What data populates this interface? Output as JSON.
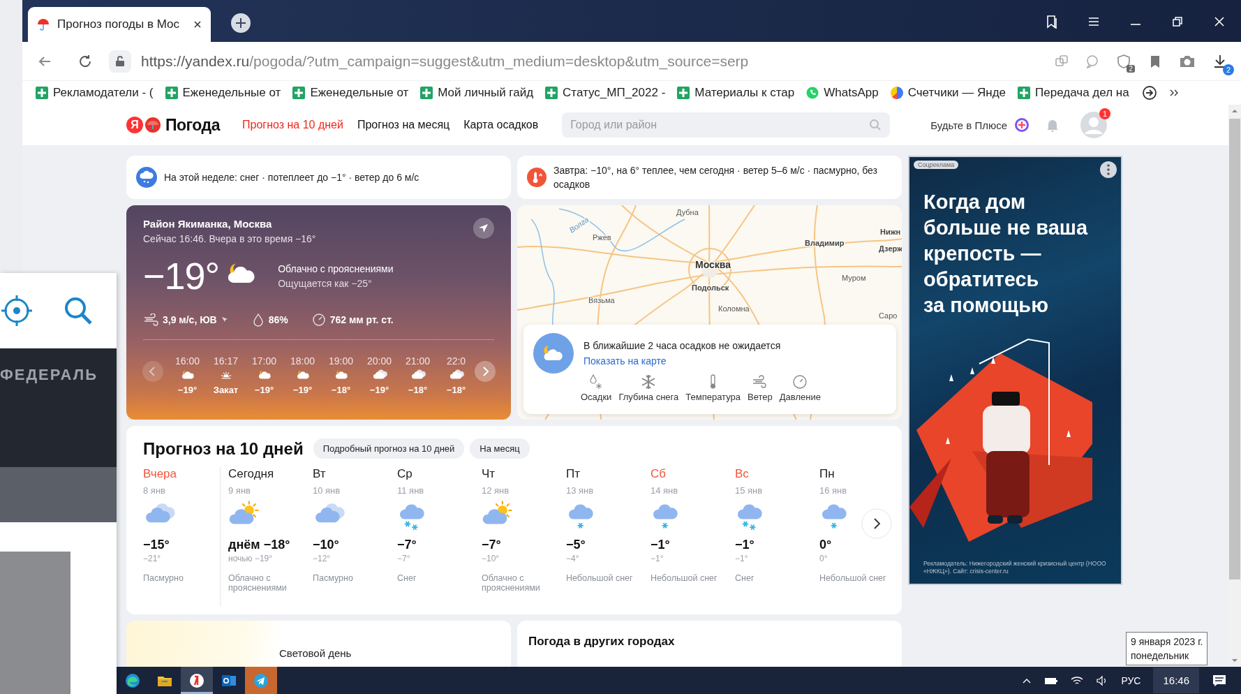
{
  "browser": {
    "tab": {
      "title": "Прогноз погоды в Мос"
    },
    "address": {
      "host": "https://yandex.ru",
      "path": "/pogoda/?utm_campaign=suggest&utm_medium=desktop&utm_source=serp"
    },
    "badges": [
      "2",
      "2"
    ],
    "bookmarks": [
      {
        "label": "Рекламодатели - (",
        "kind": "sheet"
      },
      {
        "label": "Еженедельные от",
        "kind": "sheet"
      },
      {
        "label": "Еженедельные от",
        "kind": "sheet"
      },
      {
        "label": "Мой личный гайд",
        "kind": "sheet"
      },
      {
        "label": "Статус_МП_2022 -",
        "kind": "sheet"
      },
      {
        "label": "Материалы к стар",
        "kind": "sheet"
      },
      {
        "label": "WhatsApp",
        "kind": "whatsapp"
      },
      {
        "label": "Счетчики — Янде",
        "kind": "metrica"
      },
      {
        "label": "Передача дел на",
        "kind": "sheet"
      }
    ]
  },
  "header": {
    "logo_letter": "Я",
    "logo_text": "Погода",
    "nav": [
      {
        "label": "Прогноз на 10 дней",
        "selected": true
      },
      {
        "label": "Прогноз на месяц",
        "selected": false
      },
      {
        "label": "Карта осадков",
        "selected": false
      }
    ],
    "search": {
      "placeholder": "Город или район"
    },
    "plus_label": "Будьте в Плюсе",
    "avatar_badge": "1"
  },
  "alerts": [
    {
      "kind": "snow",
      "text": "На этой неделе: снег · потеплеет до −1° · ветер до 6 м/с"
    },
    {
      "kind": "warm",
      "text": "Завтра: −10°, на 6° теплее, чем сегодня · ветер 5–6 м/с · пасмурно, без осадков"
    }
  ],
  "now": {
    "location": "Район Якиманка, Москва",
    "subtitle": "Сейчас 16:46. Вчера в это время −16°",
    "temp": "−19°",
    "kind": "moon-cloud",
    "condition": "Облачно с прояснениями",
    "feels": "Ощущается как −25°",
    "wind": "3,9 м/с, ЮВ",
    "humidity": "86%",
    "pressure": "762 мм рт. ст.",
    "hours": [
      {
        "time": "16:00",
        "kind": "moon-cloud",
        "temp": "−19°"
      },
      {
        "time": "16:17",
        "kind": "sunset",
        "temp": "Закат"
      },
      {
        "time": "17:00",
        "kind": "moon-cloud",
        "temp": "−19°"
      },
      {
        "time": "18:00",
        "kind": "moon-cloud",
        "temp": "−19°"
      },
      {
        "time": "19:00",
        "kind": "moon-cloud",
        "temp": "−18°"
      },
      {
        "time": "20:00",
        "kind": "cloudy",
        "temp": "−19°"
      },
      {
        "time": "21:00",
        "kind": "cloudy",
        "temp": "−18°"
      },
      {
        "time": "22:0",
        "kind": "cloudy",
        "temp": "−18°"
      }
    ]
  },
  "map": {
    "labels": [
      {
        "text": "Волга",
        "kind": "river"
      },
      {
        "text": "Дубна",
        "kind": "town"
      },
      {
        "text": "Ржев",
        "kind": "town"
      },
      {
        "text": "Москва",
        "kind": "capital"
      },
      {
        "text": "Подольск",
        "kind": "city"
      },
      {
        "text": "Вязьма",
        "kind": "town"
      },
      {
        "text": "Коломна",
        "kind": "town"
      },
      {
        "text": "Владимир",
        "kind": "city"
      },
      {
        "text": "Муром",
        "kind": "town"
      },
      {
        "text": "Нижн",
        "kind": "city"
      },
      {
        "text": "Дзерж",
        "kind": "city"
      },
      {
        "text": "Саро",
        "kind": "town"
      }
    ],
    "precip": {
      "text": "В ближайшие 2 часа осадков не ожидается",
      "link": "Показать на карте",
      "layers": [
        {
          "kind": "precip",
          "label": "Осадки"
        },
        {
          "kind": "snow",
          "label": "Глубина снега"
        },
        {
          "kind": "temp",
          "label": "Температура"
        },
        {
          "kind": "wind",
          "label": "Ветер"
        },
        {
          "kind": "pressure",
          "label": "Давление"
        }
      ]
    }
  },
  "forecast": {
    "title": "Прогноз на 10 дней",
    "buttons": [
      "Подробный прогноз на 10 дней",
      "На месяц"
    ],
    "days": [
      {
        "name": "Вчера",
        "date": "8 янв",
        "kind": "cloudy",
        "day": "−15°",
        "night": "−21°",
        "condition": "Пасмурно",
        "accent": true
      },
      {
        "name": "Сегодня",
        "date": "9 янв",
        "kind": "sun-cloud",
        "day": "днём −18°",
        "night": "ночью −19°",
        "condition": "Облачно с прояснениями",
        "accent": false
      },
      {
        "name": "Вт",
        "date": "10 янв",
        "kind": "cloudy",
        "day": "−10°",
        "night": "−12°",
        "condition": "Пасмурно",
        "accent": false
      },
      {
        "name": "Ср",
        "date": "11 янв",
        "kind": "snow",
        "day": "−7°",
        "night": "−7°",
        "condition": "Снег",
        "accent": false
      },
      {
        "name": "Чт",
        "date": "12 янв",
        "kind": "sun-cloud",
        "day": "−7°",
        "night": "−10°",
        "condition": "Облачно с прояснениями",
        "accent": false
      },
      {
        "name": "Пт",
        "date": "13 янв",
        "kind": "light-snow",
        "day": "−5°",
        "night": "−4°",
        "condition": "Небольшой снег",
        "accent": false
      },
      {
        "name": "Сб",
        "date": "14 янв",
        "kind": "light-snow",
        "day": "−1°",
        "night": "−1°",
        "condition": "Небольшой снег",
        "accent": true
      },
      {
        "name": "Вс",
        "date": "15 янв",
        "kind": "snow",
        "day": "−1°",
        "night": "−1°",
        "condition": "Снег",
        "accent": true
      },
      {
        "name": "Пн",
        "date": "16 янв",
        "kind": "light-snow",
        "day": "0°",
        "night": "0°",
        "condition": "Небольшой снег",
        "accent": false
      }
    ]
  },
  "bottom": {
    "daylight_label": "Световой день",
    "other_cities_title": "Погода в других городах"
  },
  "ad": {
    "badge": "Соцреклама",
    "headline": [
      "Когда дом",
      "больше не ваша",
      "крепость —",
      "обратитесь",
      "за помощью"
    ],
    "disclaimer": "Рекламодатель: Нижегородский женский кризисный центр (НООО «НЖКЦ»). Сайт: crisis-center.ru"
  },
  "left_window": {
    "banner": "ФЕДЕРАЛЬ"
  },
  "taskbar": {
    "apps": [
      {
        "kind": "edge",
        "selected": false,
        "flashing": false
      },
      {
        "kind": "explorer",
        "selected": false,
        "flashing": false
      },
      {
        "kind": "yandex",
        "selected": true,
        "flashing": false
      },
      {
        "kind": "outlook",
        "selected": false,
        "flashing": false
      },
      {
        "kind": "telegram",
        "selected": false,
        "flashing": true
      }
    ],
    "lang": "РУС",
    "time": "16:46"
  },
  "tooltip": {
    "lines": [
      "9 января 2023 г.",
      "понедельник"
    ]
  }
}
